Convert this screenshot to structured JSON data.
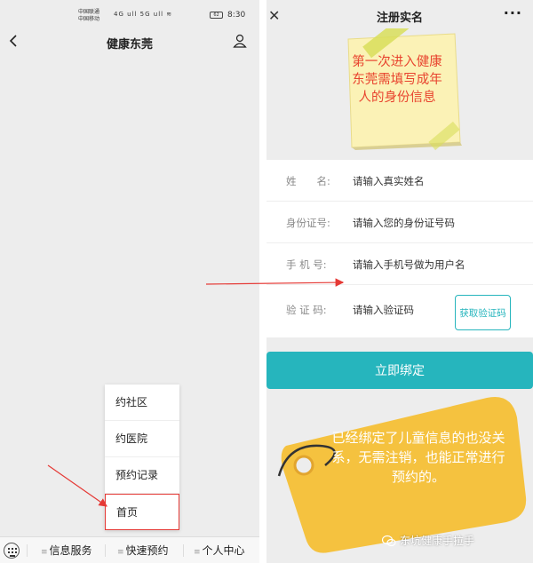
{
  "left": {
    "status": {
      "carrier1": "中国联通",
      "carrier2": "中国移动",
      "icons": "4G ull 5G ull ≋",
      "battery": "62",
      "time": "8:30"
    },
    "nav": {
      "title": "健康东莞"
    },
    "menu": [
      {
        "label": "约社区"
      },
      {
        "label": "约医院"
      },
      {
        "label": "预约记录"
      },
      {
        "label": "首页"
      }
    ],
    "bottom": [
      {
        "label": "信息服务"
      },
      {
        "label": "快速预约"
      },
      {
        "label": "个人中心"
      }
    ]
  },
  "right": {
    "nav": {
      "title": "注册实名",
      "close": "✕",
      "more": "···"
    },
    "note": "第一次进入健康东莞需填写成年人的身份信息",
    "form": {
      "rows": [
        {
          "label": "姓　　名:",
          "placeholder": "请输入真实姓名"
        },
        {
          "label": "身份证号:",
          "placeholder": "请输入您的身份证号码"
        },
        {
          "label": "手 机 号:",
          "placeholder": "请输入手机号做为用户名"
        },
        {
          "label": "验 证 码:",
          "placeholder": "请输入验证码"
        }
      ],
      "code_button": "获取验证码",
      "submit": "立即绑定"
    },
    "tag_note": "已经绑定了儿童信息的也没关系，无需注销，也能正常进行预约的。",
    "watermark": "东坑健康手拉手"
  },
  "colors": {
    "accent": "#26b5bd",
    "highlight": "#e53935",
    "note_text": "#e8442f",
    "tag": "#f5c23f"
  }
}
